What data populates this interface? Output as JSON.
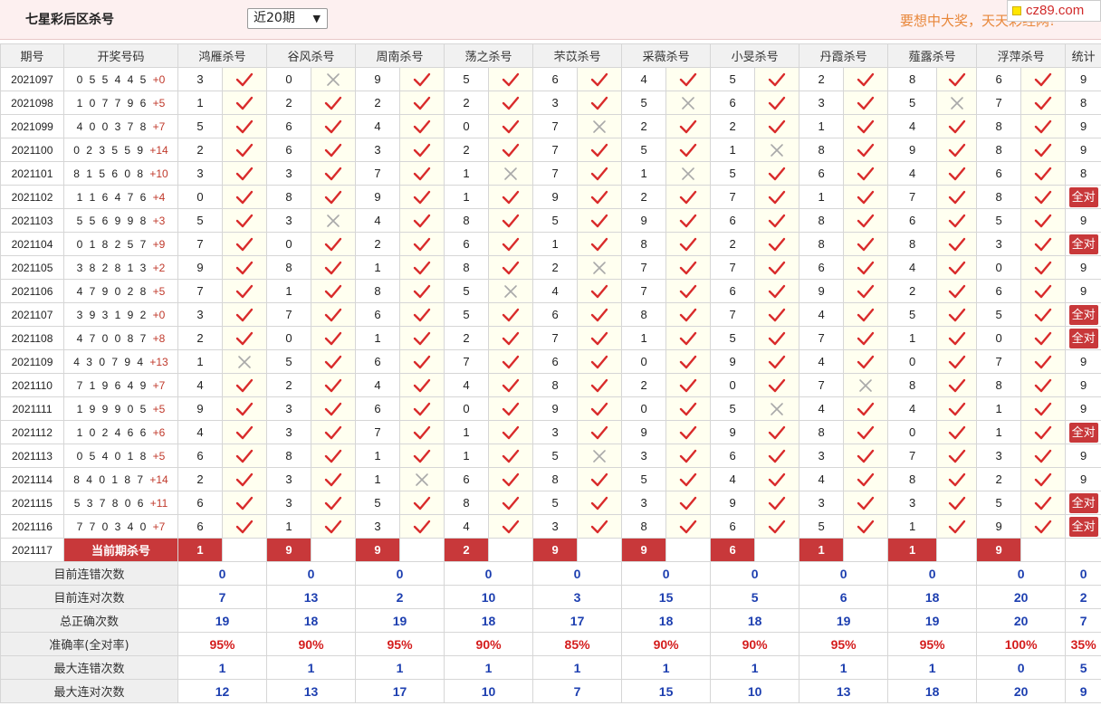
{
  "header": {
    "title": "七星彩后区杀号",
    "range_selected": "近20期",
    "slogan": "要想中大奖，天天彩经网!",
    "logo": "cz89.com"
  },
  "table": {
    "columns": [
      "期号",
      "开奖号码",
      "鸿雁杀号",
      "谷风杀号",
      "周南杀号",
      "荡之杀号",
      "芣苡杀号",
      "采薇杀号",
      "小旻杀号",
      "丹霞杀号",
      "薤露杀号",
      "浮萍杀号",
      "统计"
    ],
    "rows": [
      {
        "issue": "2021097",
        "draw": "0 5 5 4 4 5",
        "bonus": "+0",
        "picks": [
          {
            "n": "3",
            "ok": true
          },
          {
            "n": "0",
            "ok": false
          },
          {
            "n": "9",
            "ok": true
          },
          {
            "n": "5",
            "ok": true
          },
          {
            "n": "6",
            "ok": true
          },
          {
            "n": "4",
            "ok": true
          },
          {
            "n": "5",
            "ok": true
          },
          {
            "n": "2",
            "ok": true
          },
          {
            "n": "8",
            "ok": true
          },
          {
            "n": "6",
            "ok": true
          }
        ],
        "stat": "9"
      },
      {
        "issue": "2021098",
        "draw": "1 0 7 7 9 6",
        "bonus": "+5",
        "picks": [
          {
            "n": "1",
            "ok": true
          },
          {
            "n": "2",
            "ok": true
          },
          {
            "n": "2",
            "ok": true
          },
          {
            "n": "2",
            "ok": true
          },
          {
            "n": "3",
            "ok": true
          },
          {
            "n": "5",
            "ok": false
          },
          {
            "n": "6",
            "ok": true
          },
          {
            "n": "3",
            "ok": true
          },
          {
            "n": "5",
            "ok": false
          },
          {
            "n": "7",
            "ok": true
          }
        ],
        "stat": "8"
      },
      {
        "issue": "2021099",
        "draw": "4 0 0 3 7 8",
        "bonus": "+7",
        "picks": [
          {
            "n": "5",
            "ok": true
          },
          {
            "n": "6",
            "ok": true
          },
          {
            "n": "4",
            "ok": true
          },
          {
            "n": "0",
            "ok": true
          },
          {
            "n": "7",
            "ok": false
          },
          {
            "n": "2",
            "ok": true
          },
          {
            "n": "2",
            "ok": true
          },
          {
            "n": "1",
            "ok": true
          },
          {
            "n": "4",
            "ok": true
          },
          {
            "n": "8",
            "ok": true
          }
        ],
        "stat": "9"
      },
      {
        "issue": "2021100",
        "draw": "0 2 3 5 5 9",
        "bonus": "+14",
        "picks": [
          {
            "n": "2",
            "ok": true
          },
          {
            "n": "6",
            "ok": true
          },
          {
            "n": "3",
            "ok": true
          },
          {
            "n": "2",
            "ok": true
          },
          {
            "n": "7",
            "ok": true
          },
          {
            "n": "5",
            "ok": true
          },
          {
            "n": "1",
            "ok": false
          },
          {
            "n": "8",
            "ok": true
          },
          {
            "n": "9",
            "ok": true
          },
          {
            "n": "8",
            "ok": true
          }
        ],
        "stat": "9"
      },
      {
        "issue": "2021101",
        "draw": "8 1 5 6 0 8",
        "bonus": "+10",
        "picks": [
          {
            "n": "3",
            "ok": true
          },
          {
            "n": "3",
            "ok": true
          },
          {
            "n": "7",
            "ok": true
          },
          {
            "n": "1",
            "ok": false
          },
          {
            "n": "7",
            "ok": true
          },
          {
            "n": "1",
            "ok": false
          },
          {
            "n": "5",
            "ok": true
          },
          {
            "n": "6",
            "ok": true
          },
          {
            "n": "4",
            "ok": true
          },
          {
            "n": "6",
            "ok": true
          }
        ],
        "stat": "8"
      },
      {
        "issue": "2021102",
        "draw": "1 1 6 4 7 6",
        "bonus": "+4",
        "picks": [
          {
            "n": "0",
            "ok": true
          },
          {
            "n": "8",
            "ok": true
          },
          {
            "n": "9",
            "ok": true
          },
          {
            "n": "1",
            "ok": true
          },
          {
            "n": "9",
            "ok": true
          },
          {
            "n": "2",
            "ok": true
          },
          {
            "n": "7",
            "ok": true
          },
          {
            "n": "1",
            "ok": true
          },
          {
            "n": "7",
            "ok": true
          },
          {
            "n": "8",
            "ok": true
          }
        ],
        "stat": "全对"
      },
      {
        "issue": "2021103",
        "draw": "5 5 6 9 9 8",
        "bonus": "+3",
        "picks": [
          {
            "n": "5",
            "ok": true
          },
          {
            "n": "3",
            "ok": false
          },
          {
            "n": "4",
            "ok": true
          },
          {
            "n": "8",
            "ok": true
          },
          {
            "n": "5",
            "ok": true
          },
          {
            "n": "9",
            "ok": true
          },
          {
            "n": "6",
            "ok": true
          },
          {
            "n": "8",
            "ok": true
          },
          {
            "n": "6",
            "ok": true
          },
          {
            "n": "5",
            "ok": true
          }
        ],
        "stat": "9"
      },
      {
        "issue": "2021104",
        "draw": "0 1 8 2 5 7",
        "bonus": "+9",
        "picks": [
          {
            "n": "7",
            "ok": true
          },
          {
            "n": "0",
            "ok": true
          },
          {
            "n": "2",
            "ok": true
          },
          {
            "n": "6",
            "ok": true
          },
          {
            "n": "1",
            "ok": true
          },
          {
            "n": "8",
            "ok": true
          },
          {
            "n": "2",
            "ok": true
          },
          {
            "n": "8",
            "ok": true
          },
          {
            "n": "8",
            "ok": true
          },
          {
            "n": "3",
            "ok": true
          }
        ],
        "stat": "全对"
      },
      {
        "issue": "2021105",
        "draw": "3 8 2 8 1 3",
        "bonus": "+2",
        "picks": [
          {
            "n": "9",
            "ok": true
          },
          {
            "n": "8",
            "ok": true
          },
          {
            "n": "1",
            "ok": true
          },
          {
            "n": "8",
            "ok": true
          },
          {
            "n": "2",
            "ok": false
          },
          {
            "n": "7",
            "ok": true
          },
          {
            "n": "7",
            "ok": true
          },
          {
            "n": "6",
            "ok": true
          },
          {
            "n": "4",
            "ok": true
          },
          {
            "n": "0",
            "ok": true
          }
        ],
        "stat": "9"
      },
      {
        "issue": "2021106",
        "draw": "4 7 9 0 2 8",
        "bonus": "+5",
        "picks": [
          {
            "n": "7",
            "ok": true
          },
          {
            "n": "1",
            "ok": true
          },
          {
            "n": "8",
            "ok": true
          },
          {
            "n": "5",
            "ok": false
          },
          {
            "n": "4",
            "ok": true
          },
          {
            "n": "7",
            "ok": true
          },
          {
            "n": "6",
            "ok": true
          },
          {
            "n": "9",
            "ok": true
          },
          {
            "n": "2",
            "ok": true
          },
          {
            "n": "6",
            "ok": true
          }
        ],
        "stat": "9"
      },
      {
        "issue": "2021107",
        "draw": "3 9 3 1 9 2",
        "bonus": "+0",
        "picks": [
          {
            "n": "3",
            "ok": true
          },
          {
            "n": "7",
            "ok": true
          },
          {
            "n": "6",
            "ok": true
          },
          {
            "n": "5",
            "ok": true
          },
          {
            "n": "6",
            "ok": true
          },
          {
            "n": "8",
            "ok": true
          },
          {
            "n": "7",
            "ok": true
          },
          {
            "n": "4",
            "ok": true
          },
          {
            "n": "5",
            "ok": true
          },
          {
            "n": "5",
            "ok": true
          }
        ],
        "stat": "全对"
      },
      {
        "issue": "2021108",
        "draw": "4 7 0 0 8 7",
        "bonus": "+8",
        "picks": [
          {
            "n": "2",
            "ok": true
          },
          {
            "n": "0",
            "ok": true
          },
          {
            "n": "1",
            "ok": true
          },
          {
            "n": "2",
            "ok": true
          },
          {
            "n": "7",
            "ok": true
          },
          {
            "n": "1",
            "ok": true
          },
          {
            "n": "5",
            "ok": true
          },
          {
            "n": "7",
            "ok": true
          },
          {
            "n": "1",
            "ok": true
          },
          {
            "n": "0",
            "ok": true
          }
        ],
        "stat": "全对"
      },
      {
        "issue": "2021109",
        "draw": "4 3 0 7 9 4",
        "bonus": "+13",
        "picks": [
          {
            "n": "1",
            "ok": false
          },
          {
            "n": "5",
            "ok": true
          },
          {
            "n": "6",
            "ok": true
          },
          {
            "n": "7",
            "ok": true
          },
          {
            "n": "6",
            "ok": true
          },
          {
            "n": "0",
            "ok": true
          },
          {
            "n": "9",
            "ok": true
          },
          {
            "n": "4",
            "ok": true
          },
          {
            "n": "0",
            "ok": true
          },
          {
            "n": "7",
            "ok": true
          }
        ],
        "stat": "9"
      },
      {
        "issue": "2021110",
        "draw": "7 1 9 6 4 9",
        "bonus": "+7",
        "picks": [
          {
            "n": "4",
            "ok": true
          },
          {
            "n": "2",
            "ok": true
          },
          {
            "n": "4",
            "ok": true
          },
          {
            "n": "4",
            "ok": true
          },
          {
            "n": "8",
            "ok": true
          },
          {
            "n": "2",
            "ok": true
          },
          {
            "n": "0",
            "ok": true
          },
          {
            "n": "7",
            "ok": false
          },
          {
            "n": "8",
            "ok": true
          },
          {
            "n": "8",
            "ok": true
          }
        ],
        "stat": "9"
      },
      {
        "issue": "2021111",
        "draw": "1 9 9 9 0 5",
        "bonus": "+5",
        "picks": [
          {
            "n": "9",
            "ok": true
          },
          {
            "n": "3",
            "ok": true
          },
          {
            "n": "6",
            "ok": true
          },
          {
            "n": "0",
            "ok": true
          },
          {
            "n": "9",
            "ok": true
          },
          {
            "n": "0",
            "ok": true
          },
          {
            "n": "5",
            "ok": false
          },
          {
            "n": "4",
            "ok": true
          },
          {
            "n": "4",
            "ok": true
          },
          {
            "n": "1",
            "ok": true
          }
        ],
        "stat": "9"
      },
      {
        "issue": "2021112",
        "draw": "1 0 2 4 6 6",
        "bonus": "+6",
        "picks": [
          {
            "n": "4",
            "ok": true
          },
          {
            "n": "3",
            "ok": true
          },
          {
            "n": "7",
            "ok": true
          },
          {
            "n": "1",
            "ok": true
          },
          {
            "n": "3",
            "ok": true
          },
          {
            "n": "9",
            "ok": true
          },
          {
            "n": "9",
            "ok": true
          },
          {
            "n": "8",
            "ok": true
          },
          {
            "n": "0",
            "ok": true
          },
          {
            "n": "1",
            "ok": true
          }
        ],
        "stat": "全对"
      },
      {
        "issue": "2021113",
        "draw": "0 5 4 0 1 8",
        "bonus": "+5",
        "picks": [
          {
            "n": "6",
            "ok": true
          },
          {
            "n": "8",
            "ok": true
          },
          {
            "n": "1",
            "ok": true
          },
          {
            "n": "1",
            "ok": true
          },
          {
            "n": "5",
            "ok": false
          },
          {
            "n": "3",
            "ok": true
          },
          {
            "n": "6",
            "ok": true
          },
          {
            "n": "3",
            "ok": true
          },
          {
            "n": "7",
            "ok": true
          },
          {
            "n": "3",
            "ok": true
          }
        ],
        "stat": "9"
      },
      {
        "issue": "2021114",
        "draw": "8 4 0 1 8 7",
        "bonus": "+14",
        "picks": [
          {
            "n": "2",
            "ok": true
          },
          {
            "n": "3",
            "ok": true
          },
          {
            "n": "1",
            "ok": false
          },
          {
            "n": "6",
            "ok": true
          },
          {
            "n": "8",
            "ok": true
          },
          {
            "n": "5",
            "ok": true
          },
          {
            "n": "4",
            "ok": true
          },
          {
            "n": "4",
            "ok": true
          },
          {
            "n": "8",
            "ok": true
          },
          {
            "n": "2",
            "ok": true
          }
        ],
        "stat": "9"
      },
      {
        "issue": "2021115",
        "draw": "5 3 7 8 0 6",
        "bonus": "+11",
        "picks": [
          {
            "n": "6",
            "ok": true
          },
          {
            "n": "3",
            "ok": true
          },
          {
            "n": "5",
            "ok": true
          },
          {
            "n": "8",
            "ok": true
          },
          {
            "n": "5",
            "ok": true
          },
          {
            "n": "3",
            "ok": true
          },
          {
            "n": "9",
            "ok": true
          },
          {
            "n": "3",
            "ok": true
          },
          {
            "n": "3",
            "ok": true
          },
          {
            "n": "5",
            "ok": true
          }
        ],
        "stat": "全对"
      },
      {
        "issue": "2021116",
        "draw": "7 7 0 3 4 0",
        "bonus": "+7",
        "picks": [
          {
            "n": "6",
            "ok": true
          },
          {
            "n": "1",
            "ok": true
          },
          {
            "n": "3",
            "ok": true
          },
          {
            "n": "4",
            "ok": true
          },
          {
            "n": "3",
            "ok": true
          },
          {
            "n": "8",
            "ok": true
          },
          {
            "n": "6",
            "ok": true
          },
          {
            "n": "5",
            "ok": true
          },
          {
            "n": "1",
            "ok": true
          },
          {
            "n": "9",
            "ok": true
          }
        ],
        "stat": "全对"
      }
    ],
    "current": {
      "issue": "2021117",
      "label": "当前期杀号",
      "picks": [
        "1",
        "9",
        "9",
        "2",
        "9",
        "9",
        "6",
        "1",
        "1",
        "9"
      ]
    },
    "stats": [
      {
        "label": "目前连错次数",
        "values": [
          "0",
          "0",
          "0",
          "0",
          "0",
          "0",
          "0",
          "0",
          "0",
          "0"
        ],
        "total": "0"
      },
      {
        "label": "目前连对次数",
        "values": [
          "7",
          "13",
          "2",
          "10",
          "3",
          "15",
          "5",
          "6",
          "18",
          "20"
        ],
        "total": "2"
      },
      {
        "label": "总正确次数",
        "values": [
          "19",
          "18",
          "19",
          "18",
          "17",
          "18",
          "18",
          "19",
          "19",
          "20"
        ],
        "total": "7"
      },
      {
        "label": "准确率(全对率)",
        "values": [
          "95%",
          "90%",
          "95%",
          "90%",
          "85%",
          "90%",
          "90%",
          "95%",
          "95%",
          "100%"
        ],
        "total": "35%",
        "rate": true
      },
      {
        "label": "最大连错次数",
        "values": [
          "1",
          "1",
          "1",
          "1",
          "1",
          "1",
          "1",
          "1",
          "1",
          "0"
        ],
        "total": "5"
      },
      {
        "label": "最大连对次数",
        "values": [
          "12",
          "13",
          "17",
          "10",
          "7",
          "15",
          "10",
          "13",
          "18",
          "20"
        ],
        "total": "9"
      }
    ]
  },
  "icons": {
    "ok": "check-icon",
    "fail": "cross-icon"
  },
  "colors": {
    "check": "#d92b2b",
    "cross": "#a9a9a9",
    "accent": "#c8383a",
    "stat_blue": "#1d3fb0",
    "rate_red": "#d41d1d"
  }
}
